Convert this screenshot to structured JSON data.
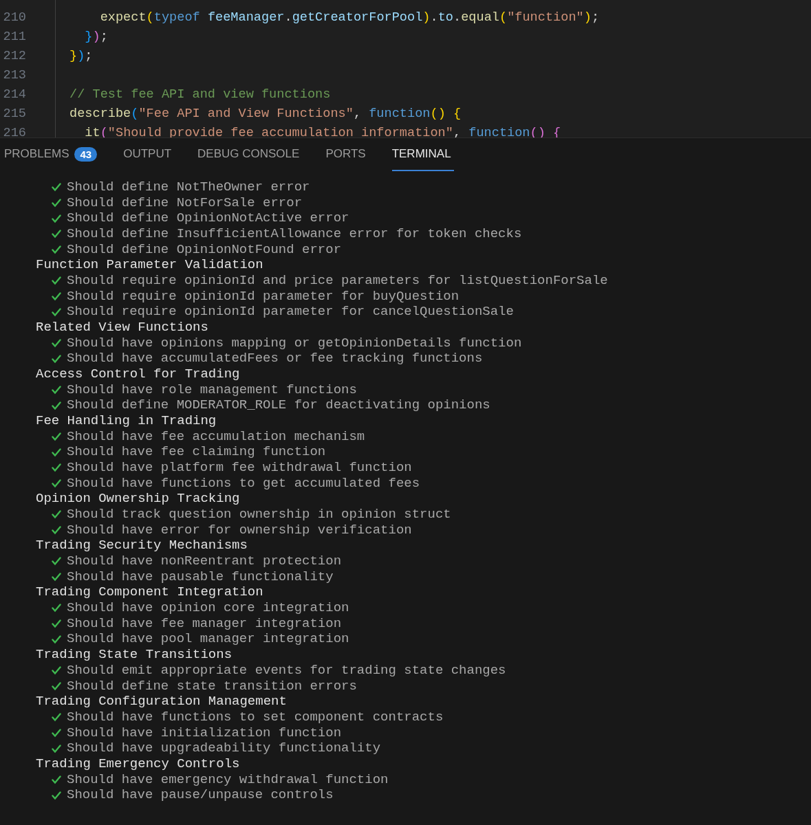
{
  "editor": {
    "lines": [
      {
        "number": "210",
        "tokens": [
          {
            "text": "    expect",
            "kind": "function"
          },
          {
            "text": "(",
            "kind": "bracket1"
          },
          {
            "text": "typeof",
            "kind": "keyword"
          },
          {
            "text": " feeManager",
            "kind": "variable"
          },
          {
            "text": ".",
            "kind": "plain"
          },
          {
            "text": "getCreatorForPool",
            "kind": "variable"
          },
          {
            "text": ")",
            "kind": "bracket1"
          },
          {
            "text": ".",
            "kind": "plain"
          },
          {
            "text": "to",
            "kind": "variable"
          },
          {
            "text": ".",
            "kind": "plain"
          },
          {
            "text": "equal",
            "kind": "function"
          },
          {
            "text": "(",
            "kind": "bracket1"
          },
          {
            "text": "\"function\"",
            "kind": "string"
          },
          {
            "text": ")",
            "kind": "bracket1"
          },
          {
            "text": ";",
            "kind": "plain"
          }
        ]
      },
      {
        "number": "211",
        "tokens": [
          {
            "text": "  }",
            "kind": "bracket3"
          },
          {
            "text": ")",
            "kind": "bracket2"
          },
          {
            "text": ";",
            "kind": "plain"
          }
        ]
      },
      {
        "number": "212",
        "tokens": [
          {
            "text": "}",
            "kind": "bracket1"
          },
          {
            "text": ")",
            "kind": "bracket3"
          },
          {
            "text": ";",
            "kind": "plain"
          }
        ]
      },
      {
        "number": "213"
      },
      {
        "number": "214",
        "tokens": [
          {
            "text": "// Test fee API and view functions",
            "kind": "comment"
          }
        ]
      },
      {
        "number": "215",
        "tokens": [
          {
            "text": "describe",
            "kind": "function"
          },
          {
            "text": "(",
            "kind": "bracket3"
          },
          {
            "text": "\"Fee API and View Functions\"",
            "kind": "string"
          },
          {
            "text": ", ",
            "kind": "plain"
          },
          {
            "text": "function",
            "kind": "keyword"
          },
          {
            "text": "()",
            "kind": "bracket1"
          },
          {
            "text": " {",
            "kind": "bracket1"
          }
        ]
      },
      {
        "number": "216",
        "tokens": [
          {
            "text": "  it",
            "kind": "function"
          },
          {
            "text": "(",
            "kind": "bracket2"
          },
          {
            "text": "\"Should provide fee accumulation information\"",
            "kind": "string"
          },
          {
            "text": ", ",
            "kind": "plain"
          },
          {
            "text": "function",
            "kind": "keyword"
          },
          {
            "text": "()",
            "kind": "bracket2"
          },
          {
            "text": " {",
            "kind": "bracket2"
          }
        ]
      }
    ]
  },
  "panel_tabs": [
    {
      "label": "PROBLEMS",
      "badge": "43",
      "selected": false
    },
    {
      "label": "OUTPUT",
      "selected": false
    },
    {
      "label": "DEBUG CONSOLE",
      "selected": false
    },
    {
      "label": "PORTS",
      "selected": false
    },
    {
      "label": "TERMINAL",
      "selected": true
    }
  ],
  "terminal": {
    "groups": [
      {
        "tests": [
          "Should define NotTheOwner error",
          "Should define NotForSale error",
          "Should define OpinionNotActive error",
          "Should define InsufficientAllowance error for token checks",
          "Should define OpinionNotFound error"
        ]
      },
      {
        "title": "Function Parameter Validation",
        "tests": [
          "Should require opinionId and price parameters for listQuestionForSale",
          "Should require opinionId parameter for buyQuestion",
          "Should require opinionId parameter for cancelQuestionSale"
        ]
      },
      {
        "title": "Related View Functions",
        "tests": [
          "Should have opinions mapping or getOpinionDetails function",
          "Should have accumulatedFees or fee tracking functions"
        ]
      },
      {
        "title": "Access Control for Trading",
        "tests": [
          "Should have role management functions",
          "Should define MODERATOR_ROLE for deactivating opinions"
        ]
      },
      {
        "title": "Fee Handling in Trading",
        "tests": [
          "Should have fee accumulation mechanism",
          "Should have fee claiming function",
          "Should have platform fee withdrawal function",
          "Should have functions to get accumulated fees"
        ]
      },
      {
        "title": "Opinion Ownership Tracking",
        "tests": [
          "Should track question ownership in opinion struct",
          "Should have error for ownership verification"
        ]
      },
      {
        "title": "Trading Security Mechanisms",
        "tests": [
          "Should have nonReentrant protection",
          "Should have pausable functionality"
        ]
      },
      {
        "title": "Trading Component Integration",
        "tests": [
          "Should have opinion core integration",
          "Should have fee manager integration",
          "Should have pool manager integration"
        ]
      },
      {
        "title": "Trading State Transitions",
        "tests": [
          "Should emit appropriate events for trading state changes",
          "Should define state transition errors"
        ]
      },
      {
        "title": "Trading Configuration Management",
        "tests": [
          "Should have functions to set component contracts",
          "Should have initialization function",
          "Should have upgradeability functionality"
        ]
      },
      {
        "title": "Trading Emergency Controls",
        "tests": [
          "Should have emergency withdrawal function",
          "Should have pause/unpause controls"
        ]
      }
    ]
  }
}
